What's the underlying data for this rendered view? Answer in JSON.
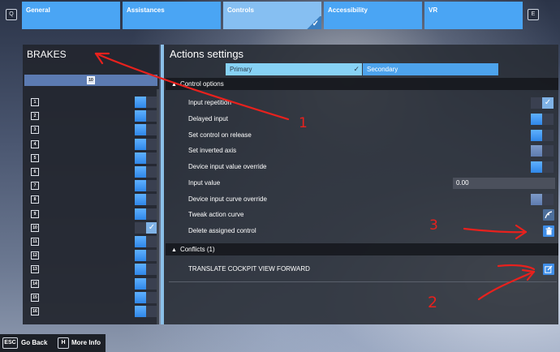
{
  "topbar": {
    "left_key": "Q",
    "right_key": "E",
    "tabs": [
      {
        "label": "General",
        "selected": false
      },
      {
        "label": "Assistances",
        "selected": false
      },
      {
        "label": "Controls",
        "selected": true
      },
      {
        "label": "Accessibility",
        "selected": false
      },
      {
        "label": "VR",
        "selected": false
      }
    ]
  },
  "left_panel": {
    "title": "BRAKES",
    "selected_number": "10",
    "rows": [
      {
        "num": "1",
        "checked": false
      },
      {
        "num": "2",
        "checked": false
      },
      {
        "num": "3",
        "checked": false
      },
      {
        "num": "4",
        "checked": false
      },
      {
        "num": "5",
        "checked": false
      },
      {
        "num": "6",
        "checked": false
      },
      {
        "num": "7",
        "checked": false
      },
      {
        "num": "8",
        "checked": false
      },
      {
        "num": "9",
        "checked": false
      },
      {
        "num": "10",
        "checked": true
      },
      {
        "num": "11",
        "checked": false
      },
      {
        "num": "12",
        "checked": false
      },
      {
        "num": "13",
        "checked": false
      },
      {
        "num": "14",
        "checked": false
      },
      {
        "num": "15",
        "checked": false
      },
      {
        "num": "16",
        "checked": false
      }
    ]
  },
  "right_panel": {
    "title": "Actions settings",
    "subtabs": {
      "primary": "Primary",
      "secondary": "Secondary"
    },
    "control_options_header": "Control options",
    "options": {
      "input_repetition": "Input repetition",
      "delayed_input": "Delayed input",
      "set_control_on_release": "Set control on release",
      "set_inverted_axis": "Set inverted axis",
      "device_input_value_override": "Device input value override",
      "input_value": "Input value",
      "input_value_field": "0.00",
      "device_input_curve_override": "Device input curve override",
      "tweak_action_curve": "Tweak action curve",
      "delete_assigned_control": "Delete assigned control"
    },
    "conflicts_header": "Conflicts (1)",
    "conflict_item": "TRANSLATE COCKPIT VIEW FORWARD"
  },
  "bottom_bar": {
    "esc_key": "ESC",
    "go_back": "Go Back",
    "h_key": "H",
    "more_info": "More Info"
  },
  "annotations": {
    "label_1": "1",
    "label_2": "2",
    "label_3": "3"
  },
  "colors": {
    "accent_blue": "#4aa5f4",
    "selected_tab": "#86bff2",
    "primary_subtab": "#87d2f5",
    "annotation_red": "#e8211d"
  }
}
